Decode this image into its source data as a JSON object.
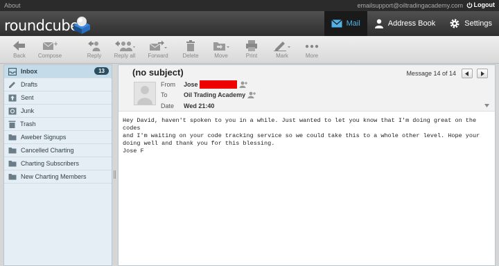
{
  "topline": {
    "about": "About",
    "email": "emailsupport@oiltradingacademy.com",
    "logout": "Logout"
  },
  "logo": {
    "text": "roundcube"
  },
  "taskbar": {
    "mail": "Mail",
    "addressbook": "Address Book",
    "settings": "Settings"
  },
  "toolbar": {
    "back": "Back",
    "compose": "Compose",
    "reply": "Reply",
    "reply_all": "Reply all",
    "forward": "Forward",
    "delete": "Delete",
    "move": "Move",
    "print": "Print",
    "mark": "Mark",
    "more": "More"
  },
  "folders": [
    {
      "label": "Inbox",
      "unread": "13",
      "icon": "inbox-icon"
    },
    {
      "label": "Drafts",
      "icon": "pencil-icon"
    },
    {
      "label": "Sent",
      "icon": "sent-icon"
    },
    {
      "label": "Junk",
      "icon": "junk-icon"
    },
    {
      "label": "Trash",
      "icon": "trash-icon"
    },
    {
      "label": "Aweber Signups",
      "icon": "folder-icon"
    },
    {
      "label": "Cancelled Charting",
      "icon": "folder-icon"
    },
    {
      "label": "Charting Subscribers",
      "icon": "folder-icon"
    },
    {
      "label": "New Charting Members",
      "icon": "folder-icon"
    }
  ],
  "message": {
    "subject": "(no subject)",
    "counter": "Message 14 of 14",
    "from_label": "From",
    "from_value": "Jose",
    "to_label": "To",
    "to_value": "Oil Trading Academy",
    "date_label": "Date",
    "date_value": "Wed 21:40",
    "body": "Hey David, haven't spoken to you in a while. Just wanted to let you know that I'm doing great on the codes\nand I'm waiting on your code tracking service so we could take this to a whole other level. Hope your\ndoing well and thank you for this blessing.\nJose F"
  },
  "colors": {
    "accent": "#4fb3e8",
    "redaction": "#ee0000",
    "header_bg": "#2f2f2f"
  }
}
